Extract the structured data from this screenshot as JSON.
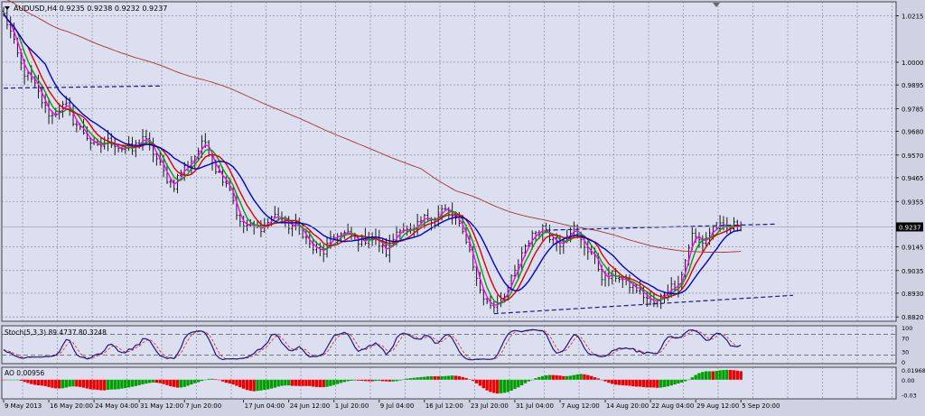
{
  "chart_data": {
    "type": "line",
    "main": {
      "header": "AUDUSD,H4  0.9235 0.9238 0.9232 0.9237",
      "current_price": "0.9237",
      "ylim": [
        0.88,
        1.028
      ],
      "yticks": [
        {
          "value": 1.0215,
          "label": "1.0215"
        },
        {
          "value": 1.0,
          "label": "1.0000"
        },
        {
          "value": 0.9895,
          "label": "0.9895"
        },
        {
          "value": 0.9785,
          "label": "0.9785"
        },
        {
          "value": 0.968,
          "label": "0.9680"
        },
        {
          "value": 0.957,
          "label": "0.9570"
        },
        {
          "value": 0.9465,
          "label": "0.9465"
        },
        {
          "value": 0.9355,
          "label": "0.9355"
        },
        {
          "value": 0.9145,
          "label": "0.9145"
        },
        {
          "value": 0.9035,
          "label": "0.9035"
        },
        {
          "value": 0.893,
          "label": "0.8930"
        },
        {
          "value": 0.882,
          "label": "0.8820"
        }
      ],
      "price_anchors": [
        [
          0,
          1.022
        ],
        [
          3,
          1.008
        ],
        [
          6,
          0.996
        ],
        [
          10,
          0.985
        ],
        [
          14,
          0.975
        ],
        [
          18,
          0.98
        ],
        [
          22,
          0.968
        ],
        [
          27,
          0.961
        ],
        [
          32,
          0.963
        ],
        [
          37,
          0.958
        ],
        [
          40,
          0.967
        ],
        [
          44,
          0.954
        ],
        [
          49,
          0.943
        ],
        [
          54,
          0.956
        ],
        [
          58,
          0.962
        ],
        [
          61,
          0.952
        ],
        [
          65,
          0.941
        ],
        [
          68,
          0.926
        ],
        [
          72,
          0.922
        ],
        [
          77,
          0.928
        ],
        [
          80,
          0.927
        ],
        [
          84,
          0.924
        ],
        [
          88,
          0.916
        ],
        [
          92,
          0.911
        ],
        [
          96,
          0.922
        ],
        [
          100,
          0.918
        ],
        [
          105,
          0.919
        ],
        [
          110,
          0.913
        ],
        [
          114,
          0.923
        ],
        [
          118,
          0.922
        ],
        [
          122,
          0.928
        ],
        [
          126,
          0.931
        ],
        [
          130,
          0.928
        ],
        [
          133,
          0.918
        ],
        [
          136,
          0.899
        ],
        [
          139,
          0.889
        ],
        [
          141,
          0.886
        ],
        [
          144,
          0.894
        ],
        [
          148,
          0.905
        ],
        [
          152,
          0.922
        ],
        [
          156,
          0.921
        ],
        [
          160,
          0.917
        ],
        [
          164,
          0.923
        ],
        [
          168,
          0.913
        ],
        [
          172,
          0.902
        ],
        [
          176,
          0.9
        ],
        [
          180,
          0.898
        ],
        [
          184,
          0.891
        ],
        [
          188,
          0.889
        ],
        [
          191,
          0.894
        ],
        [
          195,
          0.902
        ],
        [
          198,
          0.919
        ],
        [
          201,
          0.918
        ],
        [
          204,
          0.922
        ],
        [
          206,
          0.9237
        ]
      ],
      "ma_periods": [
        {
          "name": "ma-magenta",
          "color": "#ff00ff",
          "period": 3
        },
        {
          "name": "ma-green",
          "color": "#00a000",
          "period": 5
        },
        {
          "name": "ma-red",
          "color": "#dd0000",
          "period": 8
        },
        {
          "name": "ma-blue",
          "color": "#0000cc",
          "period": 13
        },
        {
          "name": "ma-slow",
          "color": "#aa3333",
          "period": 200
        }
      ],
      "trendlines": [
        {
          "name": "trendline-top-left",
          "p1": [
            0,
            0.988
          ],
          "p2": [
            45,
            0.989
          ],
          "dashed": true,
          "color": "#1a1a8c"
        },
        {
          "name": "trendline-channel-upper",
          "p1": [
            156,
            0.9222
          ],
          "p2": [
            222,
            0.925
          ],
          "dashed": true,
          "color": "#1a1a8c"
        },
        {
          "name": "trendline-channel-lower",
          "p1": [
            141,
            0.8835
          ],
          "p2": [
            227,
            0.892
          ],
          "dashed": true,
          "color": "#1a1a8c"
        }
      ]
    },
    "stoch": {
      "header": "Stoch(5,3,3) 89.4737 80.3248",
      "ylim": [
        0,
        100
      ],
      "yticks": [
        {
          "value": 100,
          "label": "100"
        },
        {
          "value": 70,
          "label": "70"
        },
        {
          "value": 30,
          "label": "30"
        },
        {
          "value": 0,
          "label": "0"
        }
      ],
      "levels": [
        80,
        20
      ]
    },
    "ao": {
      "header": "AO 0.00956",
      "ylim": [
        -0.035,
        0.0215
      ],
      "yticks": [
        {
          "value": 0.01968,
          "label": "0.01968"
        },
        {
          "value": 0.0,
          "label": "0.00"
        },
        {
          "value": -0.03,
          "label": "-0.03"
        }
      ],
      "up_color": "#00a000",
      "down_color": "#ee0000"
    },
    "x_labels": [
      {
        "index": 0,
        "label": "9 May 2013"
      },
      {
        "index": 13,
        "label": "16 May 20:00"
      },
      {
        "index": 26,
        "label": "24 May 04:00"
      },
      {
        "index": 39,
        "label": "31 May 12:00"
      },
      {
        "index": 52,
        "label": "7 Jun 20:00"
      },
      {
        "index": 69,
        "label": "17 Jun 04:00"
      },
      {
        "index": 82,
        "label": "24 Jun 12:00"
      },
      {
        "index": 95,
        "label": "1 Jul 20:00"
      },
      {
        "index": 108,
        "label": "9 Jul 04:00"
      },
      {
        "index": 121,
        "label": "16 Jul 12:00"
      },
      {
        "index": 134,
        "label": "23 Jul 20:00"
      },
      {
        "index": 147,
        "label": "31 Jul 04:00"
      },
      {
        "index": 160,
        "label": "7 Aug 12:00"
      },
      {
        "index": 173,
        "label": "14 Aug 20:00"
      },
      {
        "index": 186,
        "label": "22 Aug 04:00"
      },
      {
        "index": 199,
        "label": "29 Aug 12:00"
      },
      {
        "index": 212,
        "label": "5 Sep 20:00"
      }
    ]
  }
}
